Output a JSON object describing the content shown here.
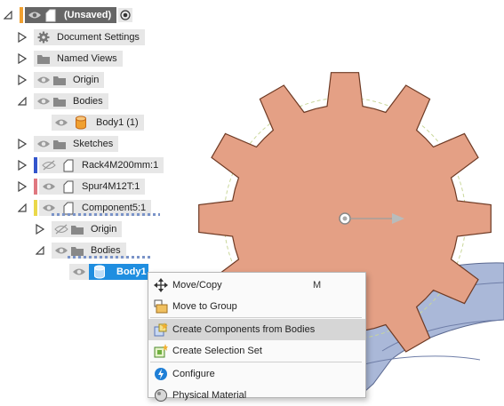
{
  "browser": {
    "root": {
      "label": "(Unsaved)"
    },
    "items": [
      {
        "label": "Document Settings"
      },
      {
        "label": "Named Views"
      },
      {
        "label": "Origin"
      },
      {
        "label": "Bodies"
      },
      {
        "label": "Body1 (1)"
      },
      {
        "label": "Sketches"
      },
      {
        "label": "Rack4M200mm:1"
      },
      {
        "label": "Spur4M12T:1"
      },
      {
        "label": "Component5:1"
      },
      {
        "label": "Origin"
      },
      {
        "label": "Bodies"
      },
      {
        "label": "Body1"
      }
    ]
  },
  "context_menu": {
    "items": [
      {
        "label": "Move/Copy",
        "shortcut": "M",
        "icon": "move-icon"
      },
      {
        "label": "Move to Group",
        "icon": "group-icon"
      },
      {
        "label": "Create Components from Bodies",
        "icon": "create-components-icon"
      },
      {
        "label": "Create Selection Set",
        "icon": "selection-set-icon"
      },
      {
        "label": "Configure",
        "icon": "configure-icon"
      },
      {
        "label": "Physical Material",
        "icon": "material-icon"
      }
    ]
  },
  "colors": {
    "gear": "#e4a085",
    "gear_edge": "#6e3a24",
    "rack": "#aab8d8",
    "selection": "#1f8ee0",
    "bar_orange": "#f0a030",
    "bar_blue": "#3355cc",
    "bar_red": "#e07880",
    "bar_yellow": "#ead84a"
  }
}
